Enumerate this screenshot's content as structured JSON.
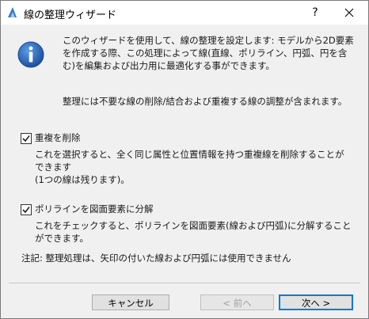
{
  "window": {
    "title": "線の整理ウィザード",
    "help_label": "?",
    "close_icon": "close-icon"
  },
  "intro": {
    "text": "このウィザードを使用して、線の整理を設定します: モデルから2D要素を作成する際、この処理によって線(直線、ポリライン、円弧、円を含む)を編集および出力用に最適化する事ができます。",
    "text2": "整理には不要な線の削除/結合および重複する線の調整が含まれます。",
    "icon": "info-icon"
  },
  "options": [
    {
      "label": "重複を削除",
      "checked": true,
      "description_line1": "これを選択すると、全く同じ属性と位置情報を持つ重複線を削除することができます",
      "description_line2": "(1つの線は残ります)。"
    },
    {
      "label": "ポリラインを図面要素に分解",
      "checked": true,
      "description_line1": "これをチェックすると、ポリラインを図面要素(線および円弧)に分解することができます。",
      "description_line2": ""
    }
  ],
  "note": "注記: 整理処理は、矢印の付いた線および円弧には使用できません",
  "buttons": {
    "cancel": "キャンセル",
    "back": "< 前へ",
    "next": "次へ >"
  },
  "colors": {
    "accent": "#0078d7",
    "info_blue": "#1e63b5"
  }
}
